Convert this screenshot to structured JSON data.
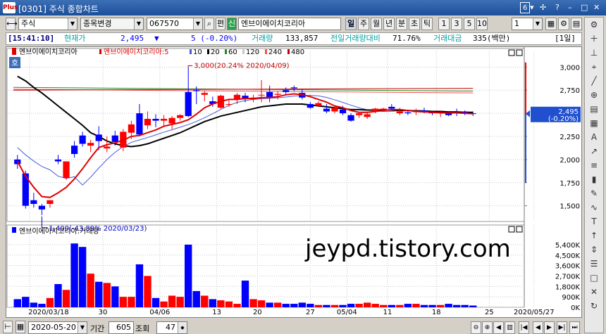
{
  "window": {
    "title": "[0301] 주식 종합차트",
    "page_num": "6",
    "logo_text": "Plus"
  },
  "toolbar": {
    "market": "주식",
    "item_change": "종목변경",
    "code": "067570",
    "pan_label": "편",
    "sin_label": "신",
    "stock_name": "엔브이에이치코리아",
    "periods": [
      "일",
      "주",
      "월",
      "년",
      "분",
      "초",
      "틱"
    ],
    "active_period": "일",
    "counts": [
      "1",
      "3",
      "5",
      "10"
    ],
    "interval": "1"
  },
  "info": {
    "time": "[15:41:10]",
    "price_label": "현재가",
    "price": "2,495",
    "arrow": "▼",
    "change": "5 (-0.20%)",
    "volume_label": "거래량",
    "volume": "133,857",
    "prev_ratio_label": "전일거래량대비",
    "prev_ratio": "71.76%",
    "amount_label": "거래대금",
    "amount": "335(백만)",
    "unit": "[1일]"
  },
  "price_panel": {
    "legend_name": "엔브이에이치코리아",
    "legend_ma": "엔브이에이치코리아:5",
    "ma_periods": [
      "10",
      "20",
      "60",
      "120",
      "240",
      "480"
    ],
    "ma_colors": [
      "#e00000",
      "#4a5ad8",
      "#000000",
      "#1e8a1e",
      "#c8c8c8",
      "#ff4d4d",
      "#c00000"
    ],
    "badge": "호",
    "high_note": "3,000(20.24% 2020/04/09)",
    "low_note": "1,400(-43.89% 2020/03/23)",
    "y_ticks": [
      "3,000",
      "2,750",
      "2,500",
      "2,250",
      "2,000",
      "1,750",
      "1,500"
    ],
    "y_values": [
      3000,
      2750,
      2500,
      2250,
      2000,
      1750,
      1500
    ],
    "ylim": [
      1330,
      3170
    ],
    "current_price": "2,495",
    "current_change": "(-0.20%)"
  },
  "volume_panel": {
    "legend": "엔브이에이치코리아:거래량",
    "y_ticks": [
      "5,400K",
      "4,500K",
      "3,600K",
      "2,700K",
      "1,800K",
      "900K",
      "0K"
    ],
    "y_values": [
      5400,
      4500,
      3600,
      2700,
      1800,
      900,
      0
    ],
    "ylim": [
      0,
      6000
    ]
  },
  "x_axis": {
    "labels": [
      "2020/03/18",
      "30",
      "04/06",
      "13",
      "20",
      "27",
      "05/04",
      "11",
      "18",
      "25",
      "2020/05/27"
    ],
    "label_index": [
      1.5,
      10.5,
      17.5,
      24.5,
      29.5,
      36,
      40.5,
      45.5,
      51.5,
      58,
      63.5
    ]
  },
  "watermark": "jeypd.tistory.com",
  "bottom": {
    "date": "2020-05-20",
    "period_label": "기간",
    "period": "605",
    "query_label": "조회",
    "query": "47"
  },
  "chart_data": {
    "type": "candlestick",
    "ohlc": [
      [
        2000,
        2050,
        1900,
        1950
      ],
      [
        1850,
        1880,
        1470,
        1500
      ],
      [
        1560,
        1640,
        1480,
        1520
      ],
      [
        1500,
        1520,
        1400,
        1460
      ],
      [
        1520,
        1560,
        1480,
        1560
      ],
      [
        2000,
        2050,
        1950,
        1980
      ],
      [
        1800,
        1980,
        1780,
        1980
      ],
      [
        2150,
        2200,
        2020,
        2060
      ],
      [
        2260,
        2300,
        2140,
        2170
      ],
      [
        2150,
        2210,
        2080,
        2180
      ],
      [
        2270,
        2360,
        2100,
        2200
      ],
      [
        2120,
        2250,
        2080,
        2140
      ],
      [
        2260,
        2310,
        2150,
        2190
      ],
      [
        2130,
        2330,
        2090,
        2300
      ],
      [
        2290,
        2420,
        2220,
        2380
      ],
      [
        2500,
        2600,
        2250,
        2270
      ],
      [
        2370,
        2520,
        2330,
        2440
      ],
      [
        2440,
        2490,
        2350,
        2420
      ],
      [
        2420,
        2480,
        2360,
        2440
      ],
      [
        2390,
        2470,
        2330,
        2450
      ],
      [
        2450,
        2490,
        2420,
        2480
      ],
      [
        2730,
        3000,
        2460,
        2470
      ],
      [
        2750,
        2790,
        2600,
        2740
      ],
      [
        2700,
        2740,
        2630,
        2720
      ],
      [
        2630,
        2680,
        2570,
        2600
      ],
      [
        2560,
        2700,
        2550,
        2690
      ],
      [
        2600,
        2650,
        2570,
        2600
      ],
      [
        2650,
        2720,
        2600,
        2700
      ],
      [
        2690,
        2720,
        2620,
        2660
      ],
      [
        2650,
        2700,
        2620,
        2670
      ],
      [
        2700,
        2860,
        2620,
        2700
      ],
      [
        2730,
        2800,
        2620,
        2670
      ],
      [
        2700,
        2740,
        2650,
        2710
      ],
      [
        2750,
        2780,
        2700,
        2730
      ],
      [
        2780,
        2800,
        2740,
        2770
      ],
      [
        2720,
        2760,
        2650,
        2670
      ],
      [
        2600,
        2620,
        2550,
        2560
      ],
      [
        2580,
        2630,
        2570,
        2610
      ],
      [
        2550,
        2600,
        2500,
        2520
      ],
      [
        2520,
        2580,
        2500,
        2560
      ],
      [
        2540,
        2580,
        2480,
        2500
      ],
      [
        2480,
        2500,
        2410,
        2420
      ],
      [
        2480,
        2500,
        2450,
        2500
      ],
      [
        2460,
        2510,
        2440,
        2490
      ],
      [
        2520,
        2560,
        2500,
        2550
      ],
      [
        2540,
        2560,
        2520,
        2550
      ],
      [
        2570,
        2600,
        2540,
        2550
      ],
      [
        2500,
        2560,
        2480,
        2520
      ],
      [
        2510,
        2540,
        2480,
        2500
      ],
      [
        2520,
        2550,
        2480,
        2520
      ],
      [
        2530,
        2560,
        2500,
        2510
      ],
      [
        2510,
        2520,
        2480,
        2500
      ],
      [
        2500,
        2530,
        2460,
        2510
      ],
      [
        2500,
        2520,
        2470,
        2480
      ],
      [
        2510,
        2550,
        2470,
        2500
      ],
      [
        2520,
        2530,
        2480,
        2500
      ],
      [
        2500,
        2520,
        2470,
        2495
      ]
    ],
    "volume": [
      700,
      900,
      400,
      300,
      800,
      2000,
      1500,
      5500,
      5200,
      2900,
      2200,
      2100,
      1800,
      900,
      900,
      3700,
      2700,
      800,
      500,
      1000,
      900,
      5400,
      1400,
      1000,
      700,
      600,
      500,
      300,
      2300,
      700,
      600,
      400,
      400,
      300,
      300,
      400,
      300,
      200,
      200,
      200,
      200,
      300,
      300,
      400,
      300,
      200,
      200,
      200,
      300,
      300,
      200,
      200,
      200,
      300,
      200,
      200,
      150
    ],
    "ma5": [
      1980,
      1820,
      1700,
      1600,
      1590,
      1640,
      1700,
      1790,
      1900,
      2020,
      2130,
      2160,
      2180,
      2210,
      2250,
      2260,
      2290,
      2320,
      2360,
      2380,
      2400,
      2430,
      2490,
      2560,
      2600,
      2630,
      2650,
      2650,
      2660,
      2660,
      2670,
      2670,
      2680,
      2700,
      2710,
      2700,
      2680,
      2650,
      2620,
      2580,
      2560,
      2530,
      2510,
      2510,
      2520,
      2530,
      2540,
      2540,
      2530,
      2520,
      2515,
      2510,
      2505,
      2505,
      2505,
      2500,
      2495
    ],
    "ma20": [
      2900,
      2850,
      2780,
      2720,
      2650,
      2580,
      2510,
      2440,
      2370,
      2290,
      2250,
      2200,
      2170,
      2150,
      2140,
      2150,
      2170,
      2200,
      2230,
      2260,
      2290,
      2330,
      2370,
      2410,
      2440,
      2470,
      2490,
      2510,
      2530,
      2550,
      2570,
      2580,
      2590,
      2600,
      2600,
      2600,
      2590,
      2580,
      2570,
      2560,
      2550,
      2540,
      2540,
      2535,
      2535,
      2535,
      2535,
      2530,
      2530,
      2525,
      2525,
      2520,
      2520,
      2515,
      2515,
      2510,
      2510
    ]
  }
}
